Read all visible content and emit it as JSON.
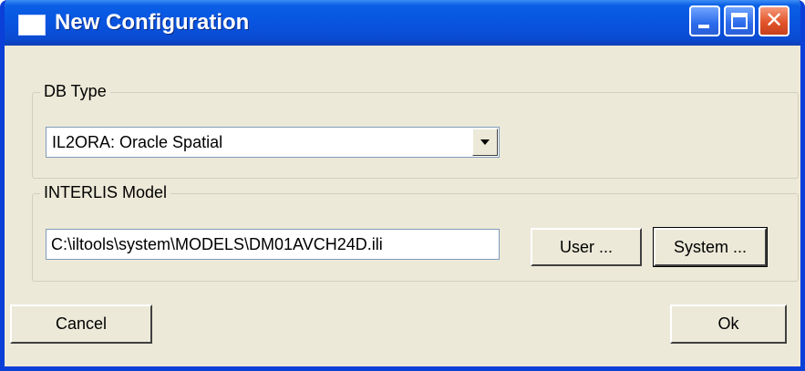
{
  "window": {
    "title": "New Configuration",
    "icons": {
      "app": "window-app-icon",
      "minimize": "minimize-icon",
      "maximize": "maximize-icon",
      "close": "close-icon"
    },
    "close_glyph": "✕"
  },
  "db_type": {
    "legend": "DB Type",
    "selected": "IL2ORA: Oracle Spatial"
  },
  "interlis_model": {
    "legend": "INTERLIS Model",
    "path_value": "C:\\iltools\\system\\MODELS\\DM01AVCH24D.ili",
    "user_button": "User ...",
    "system_button": "System ..."
  },
  "footer": {
    "cancel_button": "Cancel",
    "ok_button": "Ok"
  },
  "colors": {
    "title_bar": "#0854E0",
    "dialog_bg": "#ECE9D8",
    "close_button": "#E2542A"
  }
}
